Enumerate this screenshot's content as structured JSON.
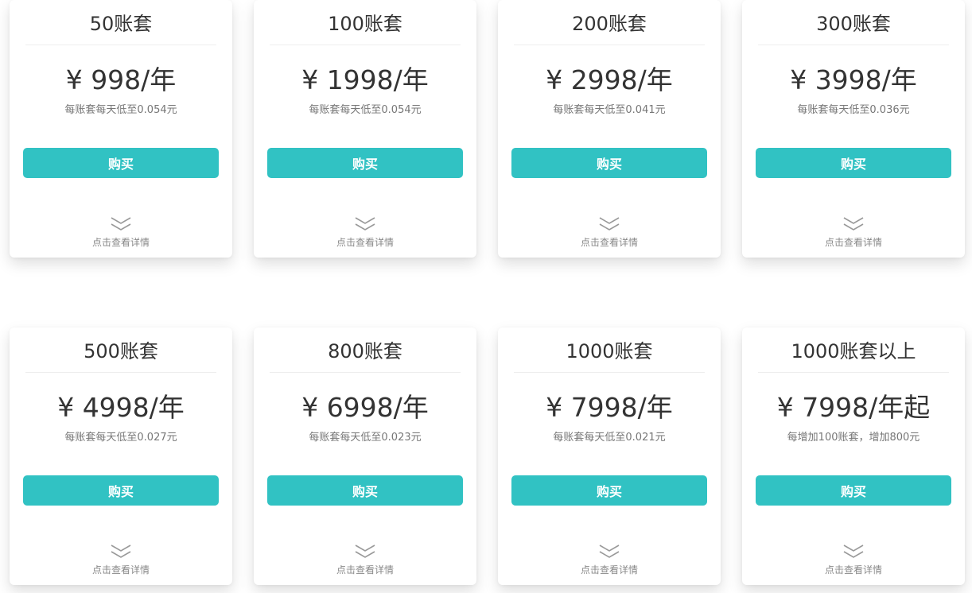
{
  "plans": [
    {
      "title": "50账套",
      "price": "¥ 998/年",
      "note": "每账套每天低至0.054元",
      "button": "购买",
      "details": "点击查看详情"
    },
    {
      "title": "100账套",
      "price": "¥ 1998/年",
      "note": "每账套每天低至0.054元",
      "button": "购买",
      "details": "点击查看详情"
    },
    {
      "title": "200账套",
      "price": "¥ 2998/年",
      "note": "每账套每天低至0.041元",
      "button": "购买",
      "details": "点击查看详情"
    },
    {
      "title": "300账套",
      "price": "¥ 3998/年",
      "note": "每账套每天低至0.036元",
      "button": "购买",
      "details": "点击查看详情"
    },
    {
      "title": "500账套",
      "price": "¥ 4998/年",
      "note": "每账套每天低至0.027元",
      "button": "购买",
      "details": "点击查看详情"
    },
    {
      "title": "800账套",
      "price": "¥ 6998/年",
      "note": "每账套每天低至0.023元",
      "button": "购买",
      "details": "点击查看详情"
    },
    {
      "title": "1000账套",
      "price": "¥ 7998/年",
      "note": "每账套每天低至0.021元",
      "button": "购买",
      "details": "点击查看详情"
    },
    {
      "title": "1000账套以上",
      "price": "¥ 7998/年起",
      "note": "每增加100账套，增加800元",
      "button": "购买",
      "details": "点击查看详情"
    }
  ],
  "colors": {
    "accent": "#31c2c3",
    "text": "#333333",
    "muted": "#777777"
  },
  "icons": {
    "expand": "double-chevron-down-icon"
  }
}
